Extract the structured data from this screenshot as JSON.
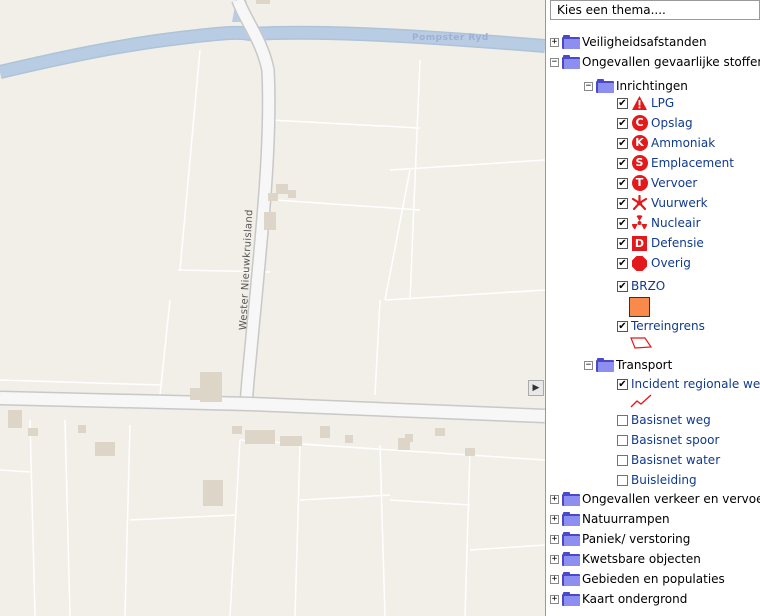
{
  "map": {
    "water_label": "Pompster Ryd",
    "road_label": "Wester Nieuwkruisland",
    "collapse_arrow": "▶"
  },
  "panel": {
    "theme_select_value": "Kies een thema....",
    "tree": {
      "veiligheidsafstanden": "Veiligheidsafstanden",
      "ongevallen_gevaarlijke_stoffen": "Ongevallen gevaarlijke stoffen",
      "inrichtingen": "Inrichtingen",
      "lpg": "LPG",
      "opslag": "Opslag",
      "ammoniak": "Ammoniak",
      "emplacement": "Emplacement",
      "vervoer": "Vervoer",
      "vuurwerk": "Vuurwerk",
      "nucleair": "Nucleair",
      "defensie": "Defensie",
      "overig": "Overig",
      "brzo": "BRZO",
      "terreingrens": "Terreingrens",
      "transport": "Transport",
      "incident_regionale_weg": "Incident regionale weg",
      "basisnet_weg": "Basisnet weg",
      "basisnet_spoor": "Basisnet spoor",
      "basisnet_water": "Basisnet water",
      "buisleiding": "Buisleiding",
      "ongevallen_verkeer": "Ongevallen verkeer en vervoer",
      "natuurrampen": "Natuurrampen",
      "paniek": "Paniek/ verstoring",
      "kwetsbare_objecten": "Kwetsbare objecten",
      "gebieden": "Gebieden en populaties",
      "kaart_ondergrond": "Kaart ondergrond"
    },
    "icon_letters": {
      "opslag": "C",
      "ammoniak": "K",
      "emplacement": "S",
      "vervoer": "T",
      "defensie": "D"
    },
    "expand_plus": "+",
    "expand_minus": "−",
    "checkmark": "✔",
    "colors": {
      "symbol_red": "#e31a1c",
      "brzo_fill": "#f98a4c",
      "link_blue": "#103a8f",
      "folder_blue": "#4a4ac8"
    }
  }
}
